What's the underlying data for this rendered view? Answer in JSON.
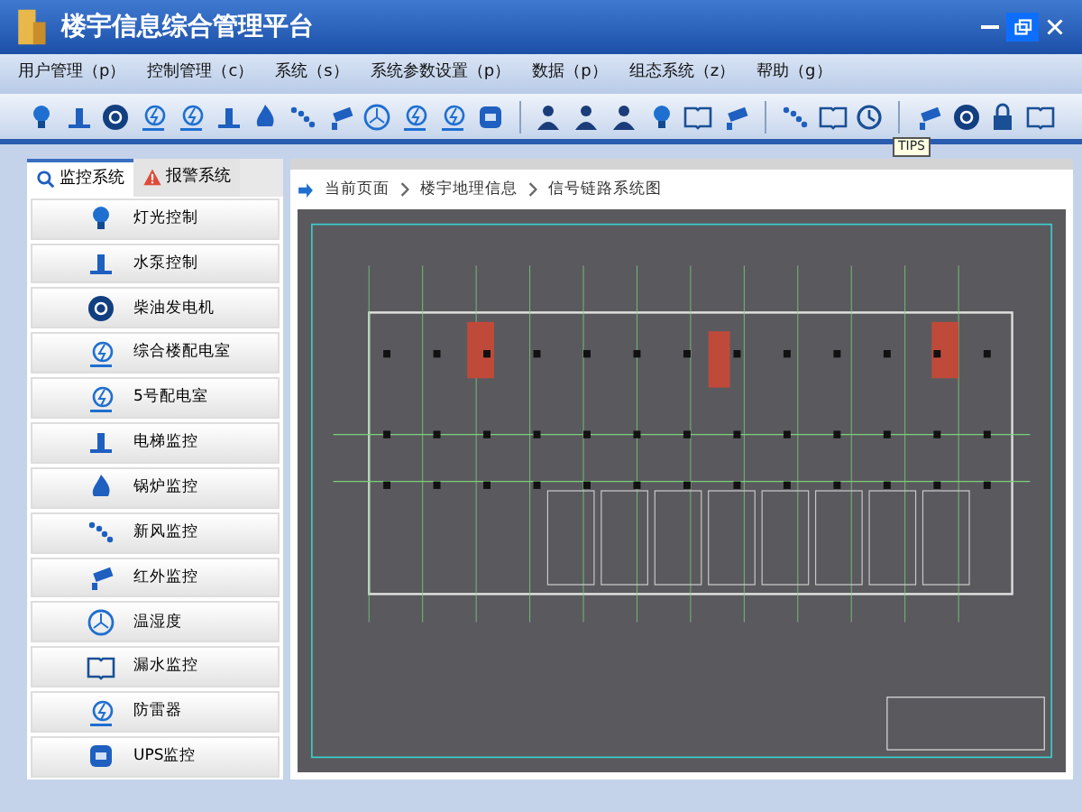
{
  "window": {
    "title": "楼宇信息综合管理平台"
  },
  "menu": [
    "用户管理（p）",
    "控制管理（c）",
    "系统（s）",
    "系统参数设置（p）",
    "数据（p）",
    "组态系统（z）",
    "帮助（g）"
  ],
  "toolbar": {
    "tooltip": "TIPS"
  },
  "tabs": [
    {
      "label": "监控系统",
      "selected": true,
      "kind": "search"
    },
    {
      "label": "报警系统",
      "selected": false,
      "kind": "warning"
    }
  ],
  "sidebar": {
    "items": [
      "灯光控制",
      "水泵控制",
      "柴油发电机",
      "综合楼配电室",
      "5号配电室",
      "电梯监控",
      "锅炉监控",
      "新风监控",
      "红外监控",
      "温湿度",
      "漏水监控",
      "防雷器",
      "UPS监控"
    ]
  },
  "breadcrumb": [
    "当前页面",
    "楼宇地理信息",
    "信号链路系统图"
  ]
}
